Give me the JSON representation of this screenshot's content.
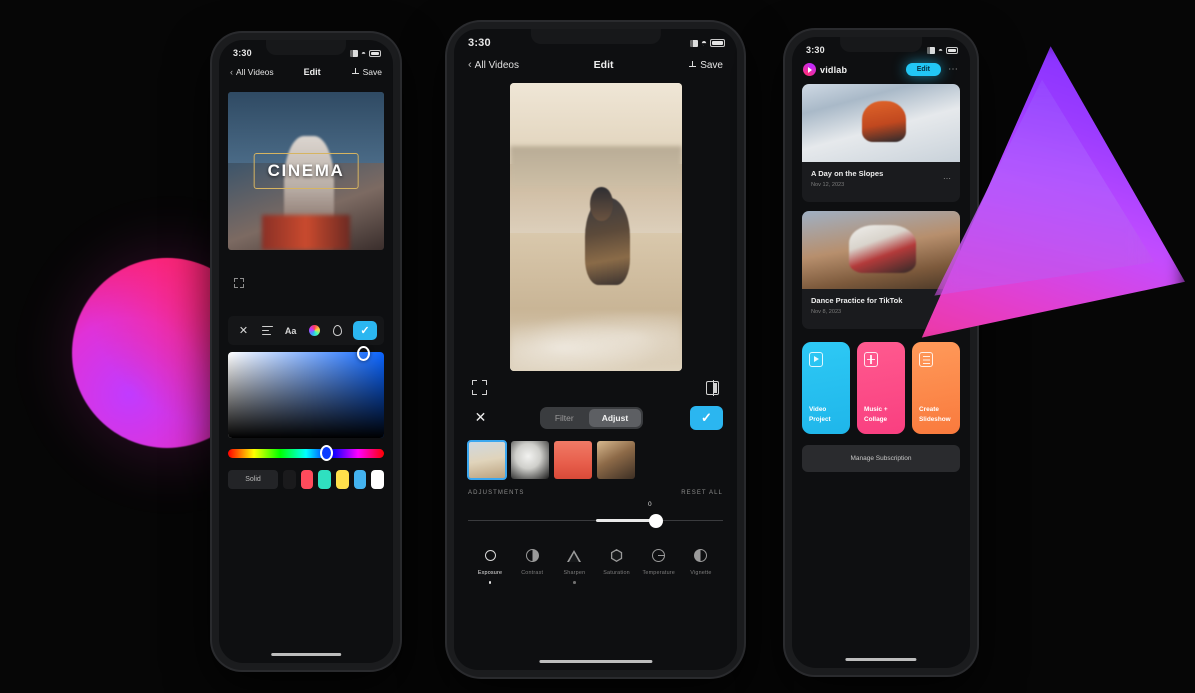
{
  "scene": {
    "background": "#060606",
    "decor": {
      "sphere_colors": [
        "#c13bff",
        "#f6237f"
      ],
      "triangle_colors": [
        "#7b2bff",
        "#f0379a"
      ]
    }
  },
  "phone_left": {
    "status": {
      "time": "3:30",
      "wifi_icon": "wifi-icon",
      "battery_icon": "battery-icon",
      "signal_icon": "signal-icon"
    },
    "nav": {
      "back_label": "All Videos",
      "title": "Edit",
      "save_label": "Save",
      "save_icon": "download-icon"
    },
    "preview": {
      "overlay_text": "CINEMA",
      "selection_color": "#d6b461"
    },
    "crop_icon": "crop-icon",
    "toolbar": [
      {
        "name": "close-icon",
        "label": "X"
      },
      {
        "name": "align-icon",
        "label": "Align"
      },
      {
        "name": "font-icon",
        "label": "Aa"
      },
      {
        "name": "palette-icon",
        "label": "Color"
      },
      {
        "name": "opacity-icon",
        "label": "Opacity"
      }
    ],
    "confirm_icon": "check-icon",
    "picker": {
      "mode_label": "Solid",
      "swatches": [
        "#1a1a1c",
        "#ff4b5c",
        "#2fe0c0",
        "#ffe04b",
        "#43b3f0",
        "#ffffff"
      ],
      "hue_position_pct": 59,
      "selected_color": "#0a3cff"
    }
  },
  "phone_mid": {
    "status": {
      "time": "3:30",
      "wifi_icon": "wifi-icon",
      "battery_icon": "battery-icon",
      "signal_icon": "signal-icon"
    },
    "nav": {
      "back_label": "All Videos",
      "title": "Edit",
      "save_label": "Save",
      "save_icon": "download-icon"
    },
    "canvas_icons": {
      "left": "crop-icon",
      "right": "compare-icon"
    },
    "controls": {
      "cancel_icon": "close-icon",
      "confirm_icon": "check-icon",
      "tabs": [
        {
          "label": "Filter",
          "active": false
        },
        {
          "label": "Adjust",
          "active": true
        }
      ]
    },
    "clips": [
      {
        "name": "clip-thumbnail-1",
        "selected": true
      },
      {
        "name": "clip-thumbnail-2",
        "selected": false
      },
      {
        "name": "clip-thumbnail-3",
        "selected": false
      },
      {
        "name": "clip-thumbnail-4",
        "selected": false
      }
    ],
    "adjust_panel": {
      "section_label": "ADJUSTMENTS",
      "reset_label": "RESET ALL",
      "slider_value": "0",
      "slider_position_pct": 71
    },
    "tools": [
      {
        "label": "Exposure",
        "icon": "sun-icon",
        "active": true
      },
      {
        "label": "Contrast",
        "icon": "contrast-icon",
        "active": false
      },
      {
        "label": "Sharpen",
        "icon": "triangle-icon",
        "active": false
      },
      {
        "label": "Saturation",
        "icon": "hexagon-icon",
        "active": false
      },
      {
        "label": "Temperature",
        "icon": "temperature-icon",
        "active": false
      },
      {
        "label": "Vignette",
        "icon": "vignette-icon",
        "active": false
      }
    ]
  },
  "phone_right": {
    "status": {
      "time": "3:30",
      "wifi_icon": "wifi-icon",
      "battery_icon": "battery-icon",
      "signal_icon": "signal-icon"
    },
    "brand": {
      "name": "vidlab",
      "logo_icon": "play-circle-icon"
    },
    "pro_button": {
      "label": "Edit",
      "color": "#22c7f5"
    },
    "menu_icon": "kebab-menu-icon",
    "videos": [
      {
        "title": "A Day on the Slopes",
        "date": "Nov 12, 2023",
        "menu_icon": "more-icon"
      },
      {
        "title": "Dance Practice for TikTok",
        "date": "Nov 8, 2023",
        "menu_icon": "more-icon"
      }
    ],
    "actions": [
      {
        "line1": "Video",
        "line2": "Project",
        "icon": "video-icon",
        "color": "#2ec9f5"
      },
      {
        "line1": "Music +",
        "line2": "Collage",
        "icon": "collage-icon",
        "color": "#ff5a8f"
      },
      {
        "line1": "Create",
        "line2": "Slideshow",
        "icon": "slides-icon",
        "color": "#ff9a5a"
      }
    ],
    "manage_label": "Manage Subscription"
  }
}
